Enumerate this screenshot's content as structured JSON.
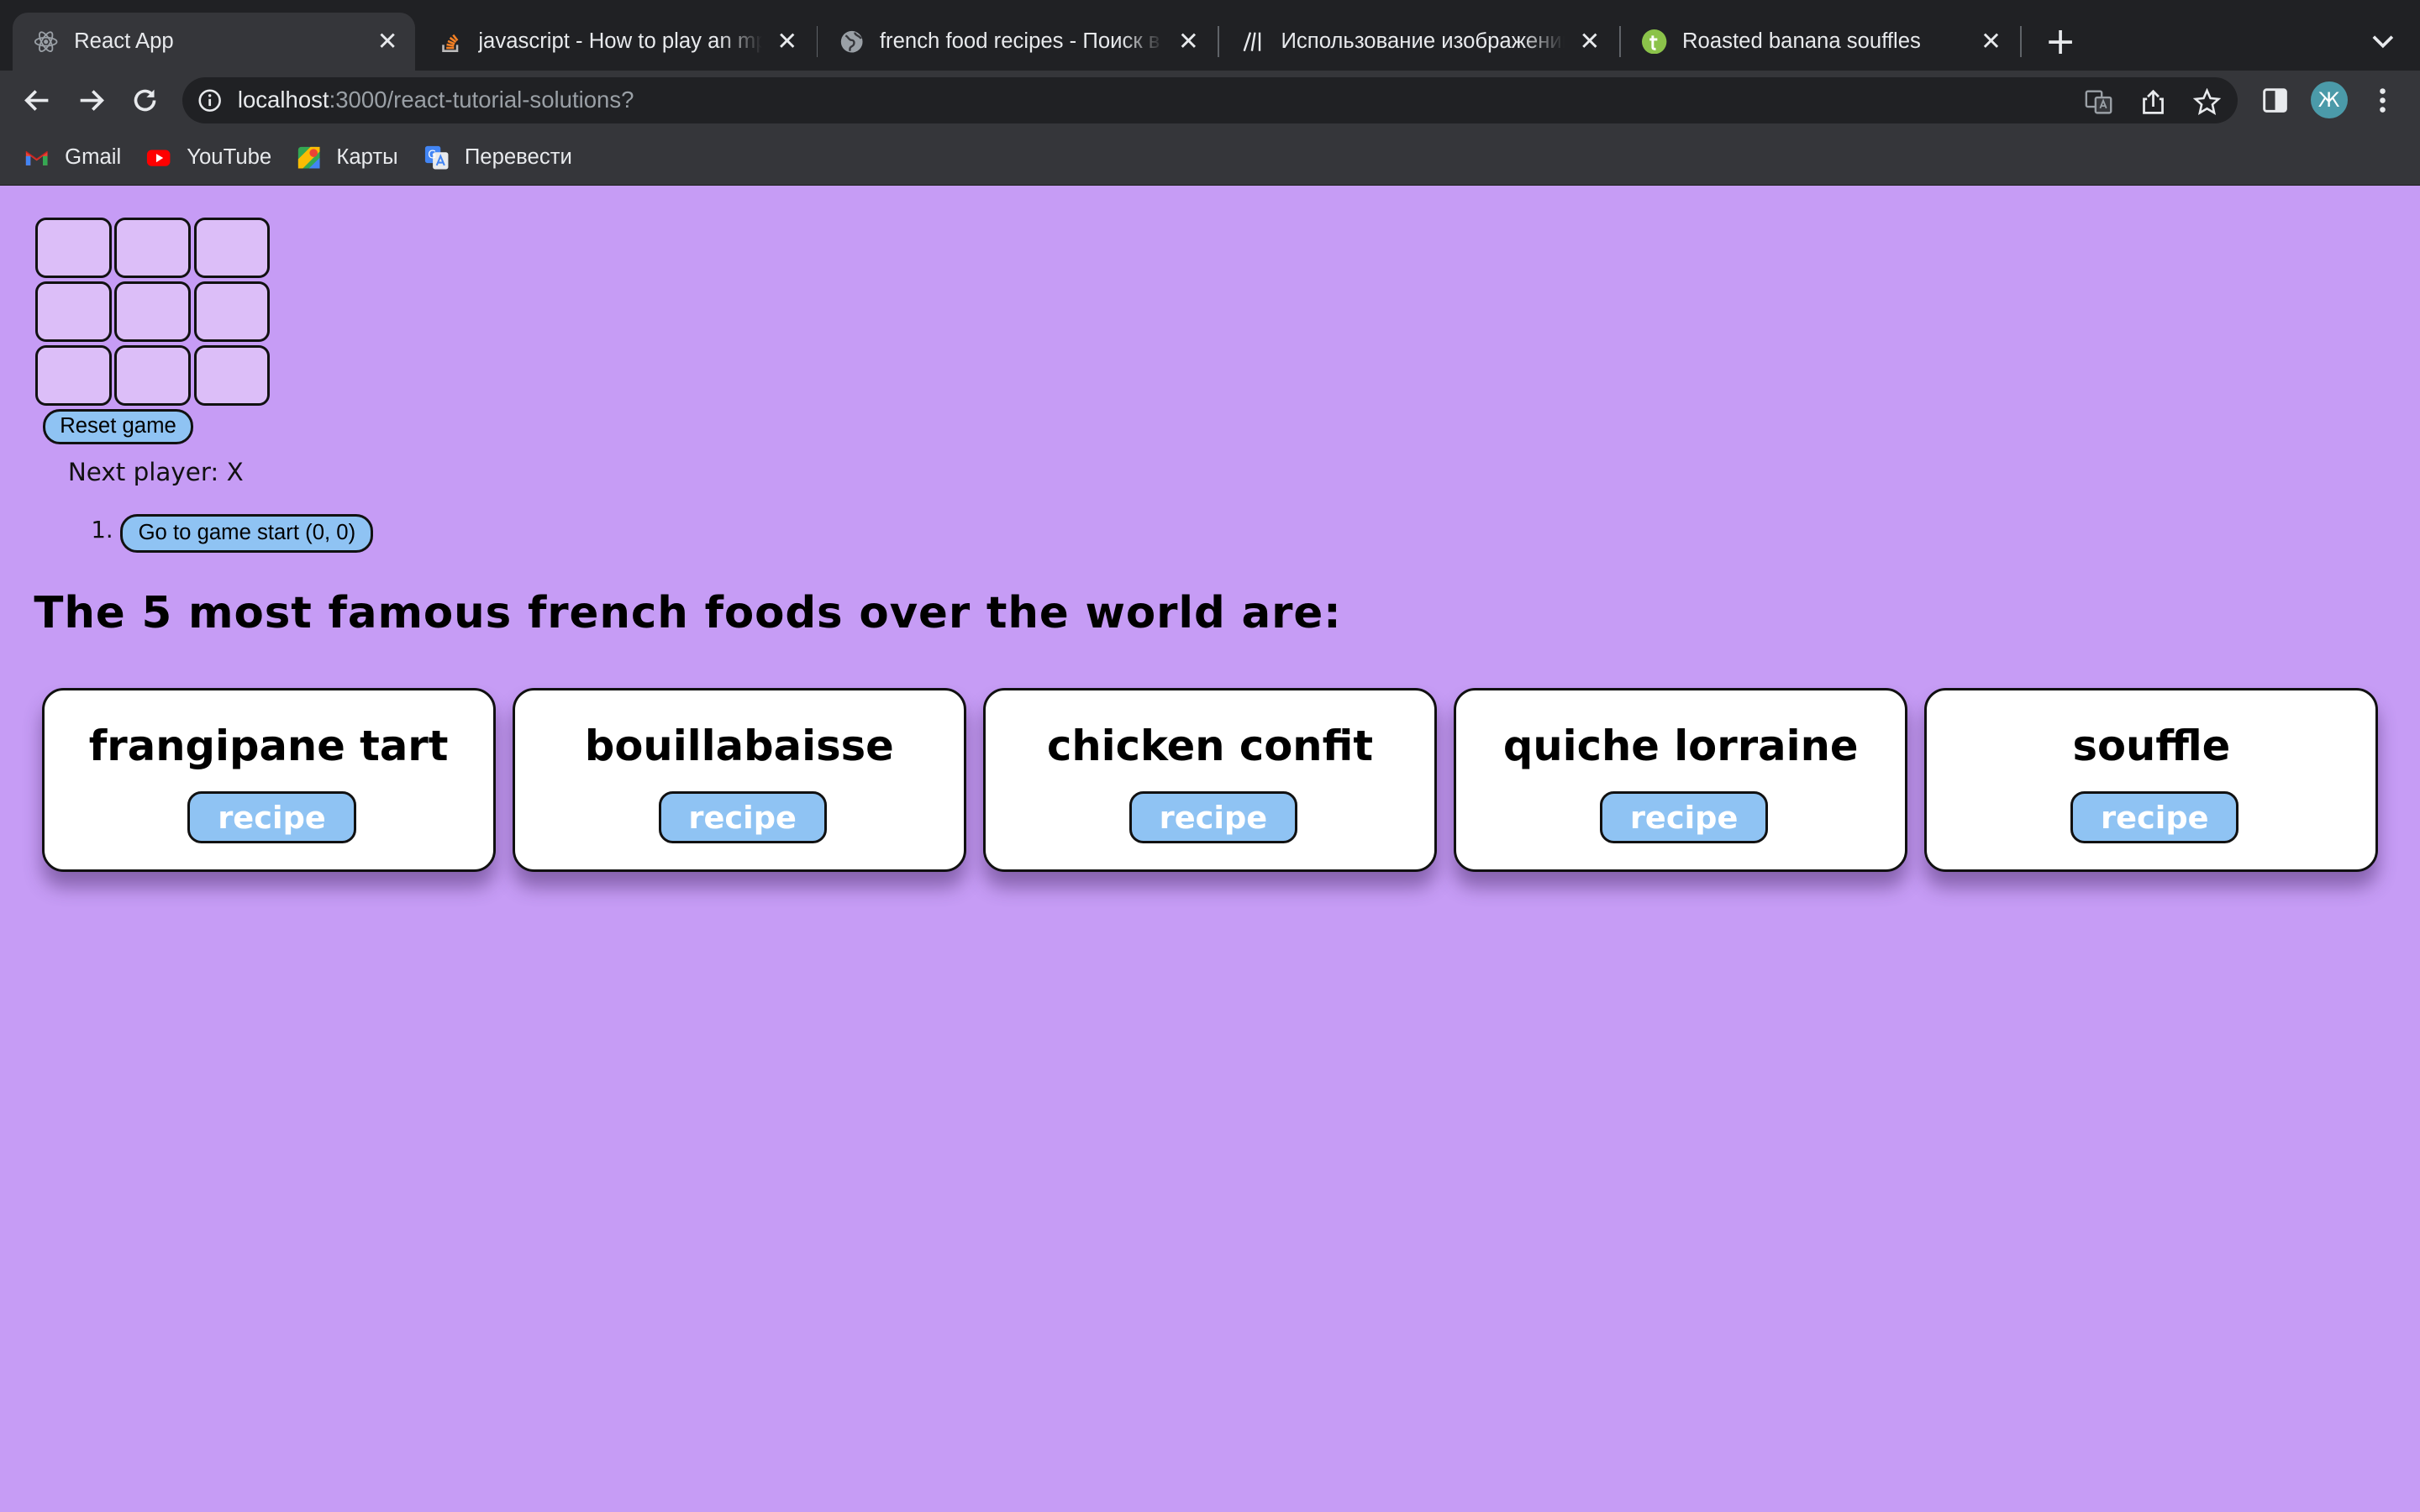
{
  "browser": {
    "tabs": [
      {
        "title": "React App",
        "icon": "react-icon",
        "active": true
      },
      {
        "title": "javascript - How to play an mp3",
        "icon": "stackoverflow-icon",
        "active": false
      },
      {
        "title": "french food recipes - Поиск в Google",
        "icon": "globe-icon",
        "active": false
      },
      {
        "title": "Использование изображений",
        "icon": "mdn-icon",
        "active": false
      },
      {
        "title": "Roasted banana souffles",
        "icon": "tasty-icon",
        "active": false
      }
    ],
    "url": {
      "host": "localhost",
      "path": ":3000/react-tutorial-solutions?"
    },
    "profile_initial": "Ж",
    "bookmarks": [
      {
        "label": "Gmail",
        "icon": "gmail-icon"
      },
      {
        "label": "YouTube",
        "icon": "youtube-icon"
      },
      {
        "label": "Карты",
        "icon": "maps-icon"
      },
      {
        "label": "Перевести",
        "icon": "translate-icon"
      }
    ]
  },
  "game": {
    "board": [
      "",
      "",
      "",
      "",
      "",
      "",
      "",
      "",
      ""
    ],
    "reset_label": "Reset game",
    "status": "Next player: X",
    "moves": [
      {
        "number": "1.",
        "label": "Go to game start (0, 0)"
      }
    ]
  },
  "foods": {
    "heading": "The 5 most famous french foods over the world are:",
    "recipe_label": "recipe",
    "items": [
      {
        "name": "frangipane tart"
      },
      {
        "name": "bouillabaisse"
      },
      {
        "name": "chicken confit"
      },
      {
        "name": "quiche lorraine"
      },
      {
        "name": "souffle"
      }
    ]
  },
  "colors": {
    "page_background": "#c69cf5",
    "square_fill": "#dcbef8",
    "button_fill": "#8fc3f3",
    "card_fill": "#ffffff"
  }
}
